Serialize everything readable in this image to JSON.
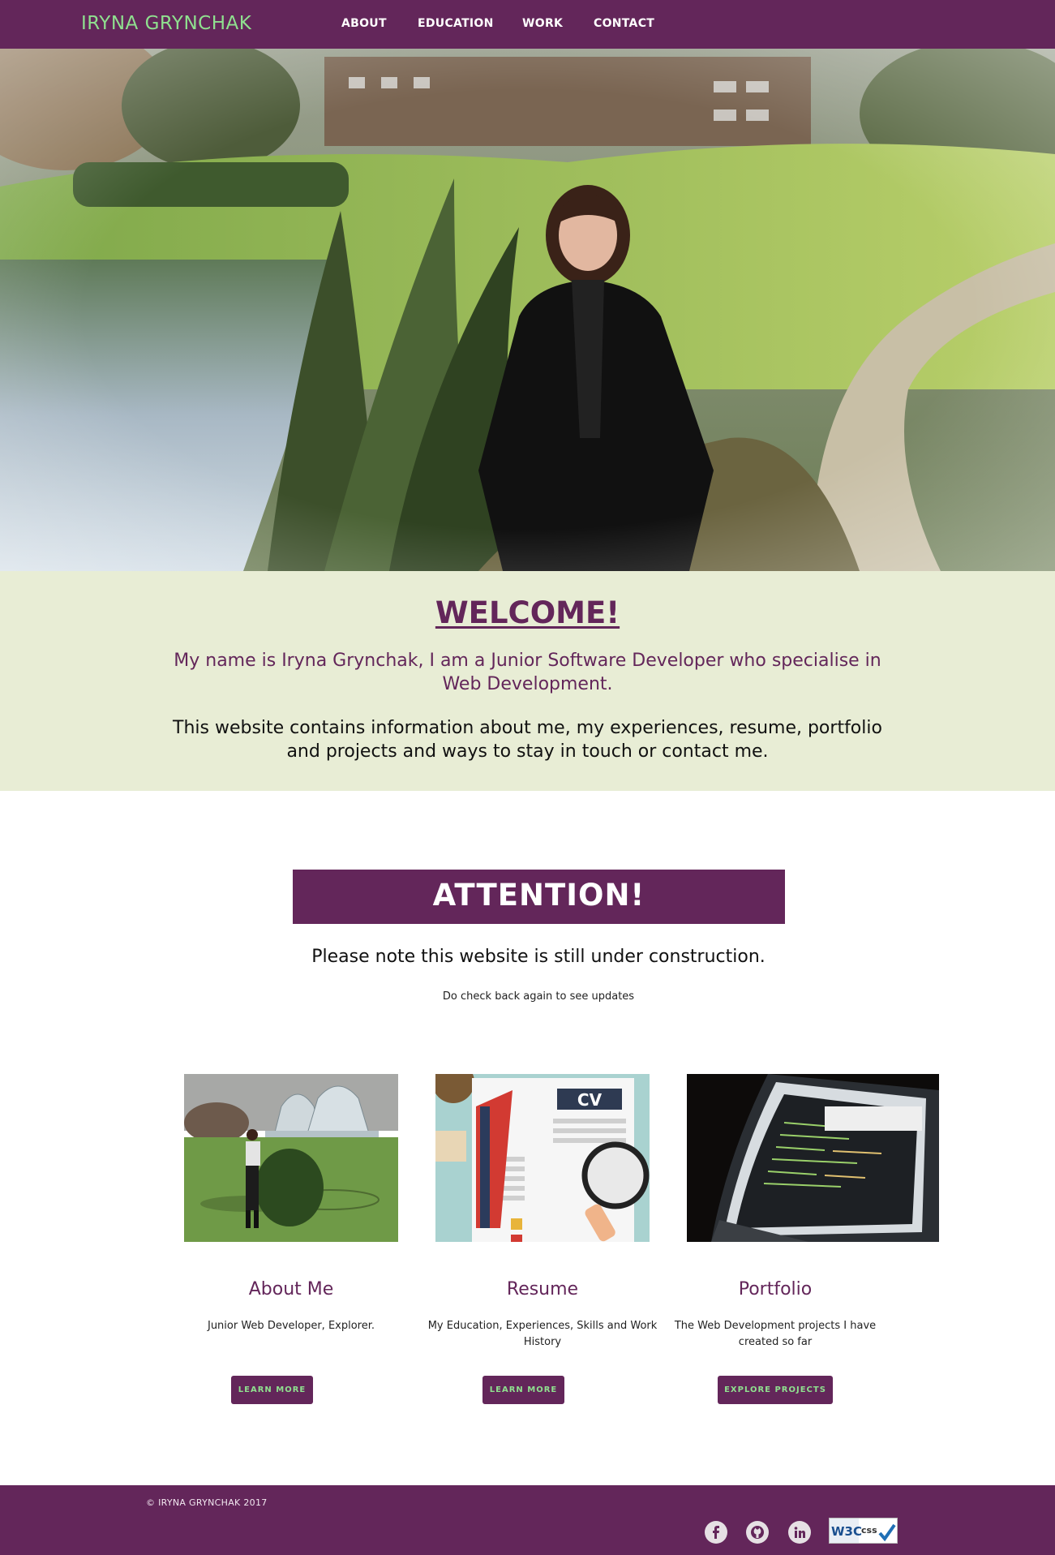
{
  "navbar": {
    "brand": "IRYNA GRYNCHAK",
    "links": [
      "ABOUT",
      "EDUCATION",
      "WORK",
      "CONTACT"
    ]
  },
  "welcome": {
    "title": "WELCOME!",
    "intro": "My name is Iryna Grynchak, I am a Junior Software Developer who specialise in Web Development.",
    "description": "This website contains information about me, my experiences, resume, portfolio and projects and ways to stay in touch or contact me."
  },
  "attention": {
    "title": "ATTENTION!",
    "note": "Please note this website is still under construction.",
    "subnote": "Do check back again to see updates"
  },
  "cards": [
    {
      "title": "About Me",
      "text": "Junior Web Developer, Explorer.",
      "button": "LEARN MORE"
    },
    {
      "title": "Resume",
      "text": "My Education, Experiences, Skills and Work History",
      "button": "LEARN MORE"
    },
    {
      "title": "Portfolio",
      "text": "The Web Development projects I have created so far",
      "button": "EXPLORE PROJECTS"
    }
  ],
  "resume_image": {
    "label": "CV"
  },
  "footer": {
    "copyright": "© IRYNA GRYNCHAK 2017",
    "social_icons": [
      "facebook-icon",
      "github-icon",
      "linkedin-icon"
    ],
    "badge": {
      "left": "W3C",
      "right": "css"
    }
  },
  "colors": {
    "brand": "#63265a",
    "accent_green": "#8fe08f",
    "welcome_bg": "#e8edd5"
  }
}
